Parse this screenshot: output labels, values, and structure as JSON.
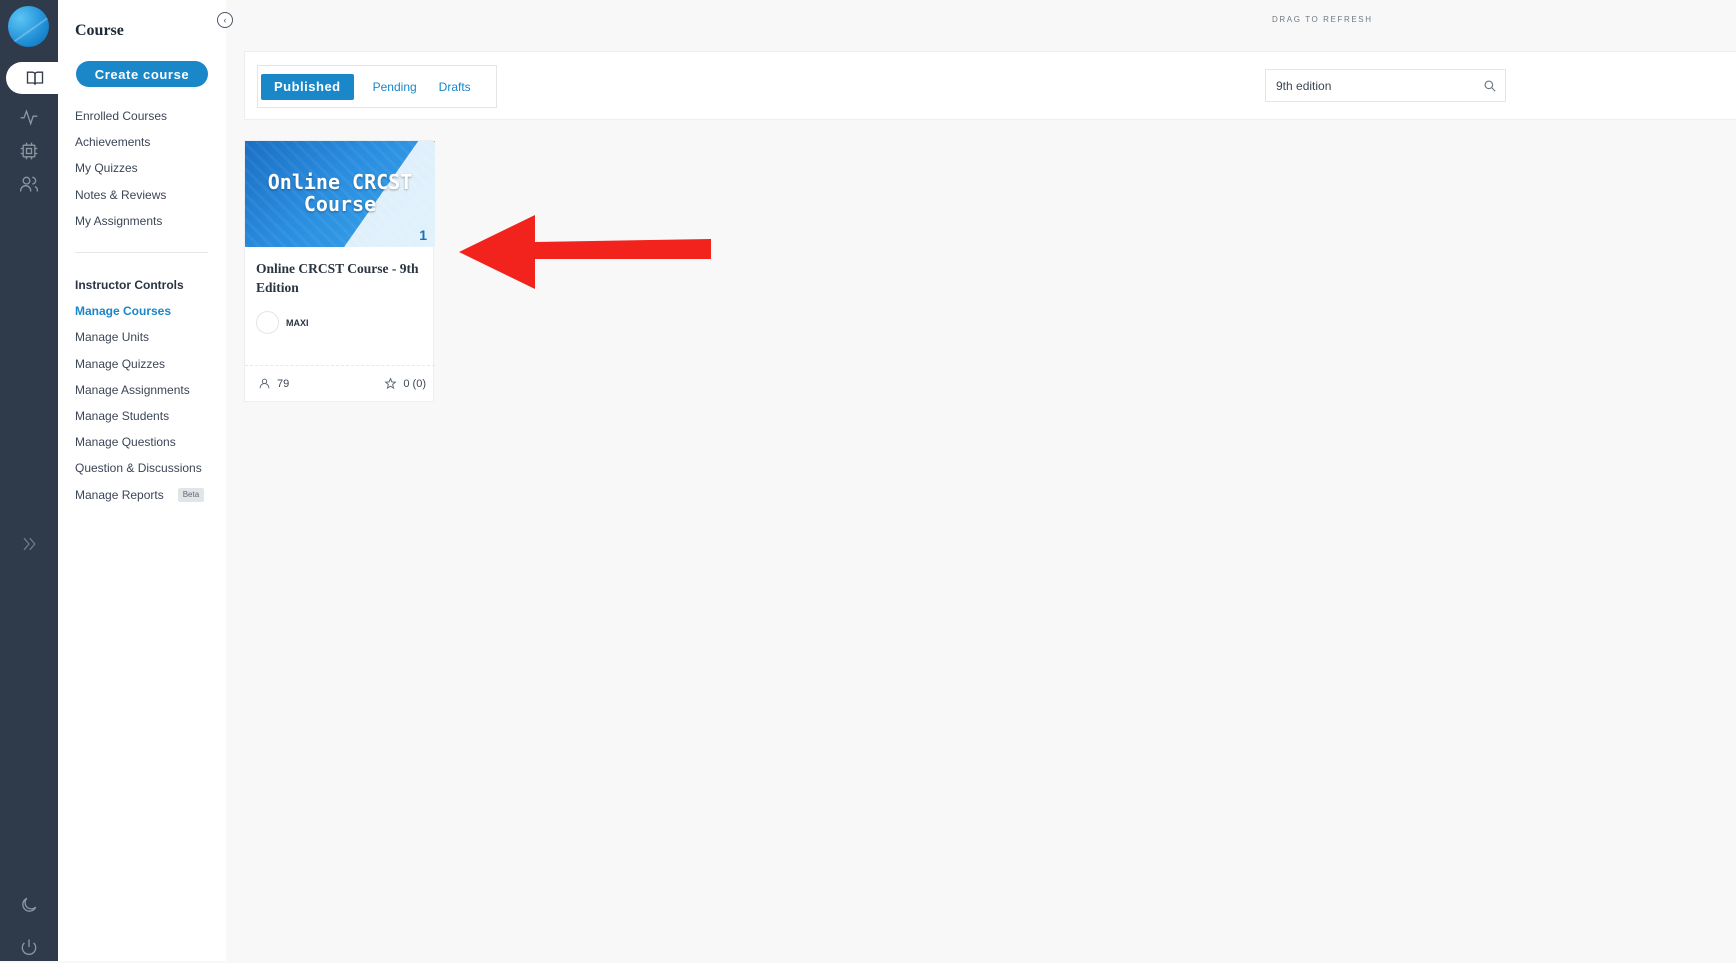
{
  "rail": {
    "icons": [
      "book-icon",
      "activity-icon",
      "chip-icon",
      "users-icon",
      "chevrons-right-icon",
      "moon-icon",
      "power-icon"
    ]
  },
  "sidebar": {
    "title": "Course",
    "create_button": "Create course",
    "menu": [
      {
        "label": "Enrolled Courses"
      },
      {
        "label": "Achievements"
      },
      {
        "label": "My Quizzes"
      },
      {
        "label": "Notes & Reviews"
      },
      {
        "label": "My Assignments"
      }
    ],
    "instructor_heading": "Instructor Controls",
    "instructor_menu": [
      {
        "label": "Manage Courses",
        "active": true
      },
      {
        "label": "Manage Units"
      },
      {
        "label": "Manage Quizzes"
      },
      {
        "label": "Manage Assignments"
      },
      {
        "label": "Manage Students"
      },
      {
        "label": "Manage Questions"
      },
      {
        "label": "Question & Discussions"
      },
      {
        "label": "Manage Reports",
        "badge": "Beta"
      }
    ]
  },
  "main": {
    "drag_hint": "DRAG TO REFRESH",
    "tabs": [
      {
        "label": "Published",
        "active": true
      },
      {
        "label": "Pending"
      },
      {
        "label": "Drafts"
      }
    ],
    "search": {
      "value": "9th edition"
    }
  },
  "course_card": {
    "thumbnail_line1": "Online CRCST",
    "thumbnail_line2": "Course",
    "thumbnail_badge": "1",
    "title": "Online CRCST Course - 9th Edition",
    "author": "MAXI",
    "students": "79",
    "rating": "0 (0)"
  },
  "colors": {
    "rail": "#2f3b4a",
    "accent": "#1a87c9",
    "annotation_arrow": "#f2231d"
  }
}
